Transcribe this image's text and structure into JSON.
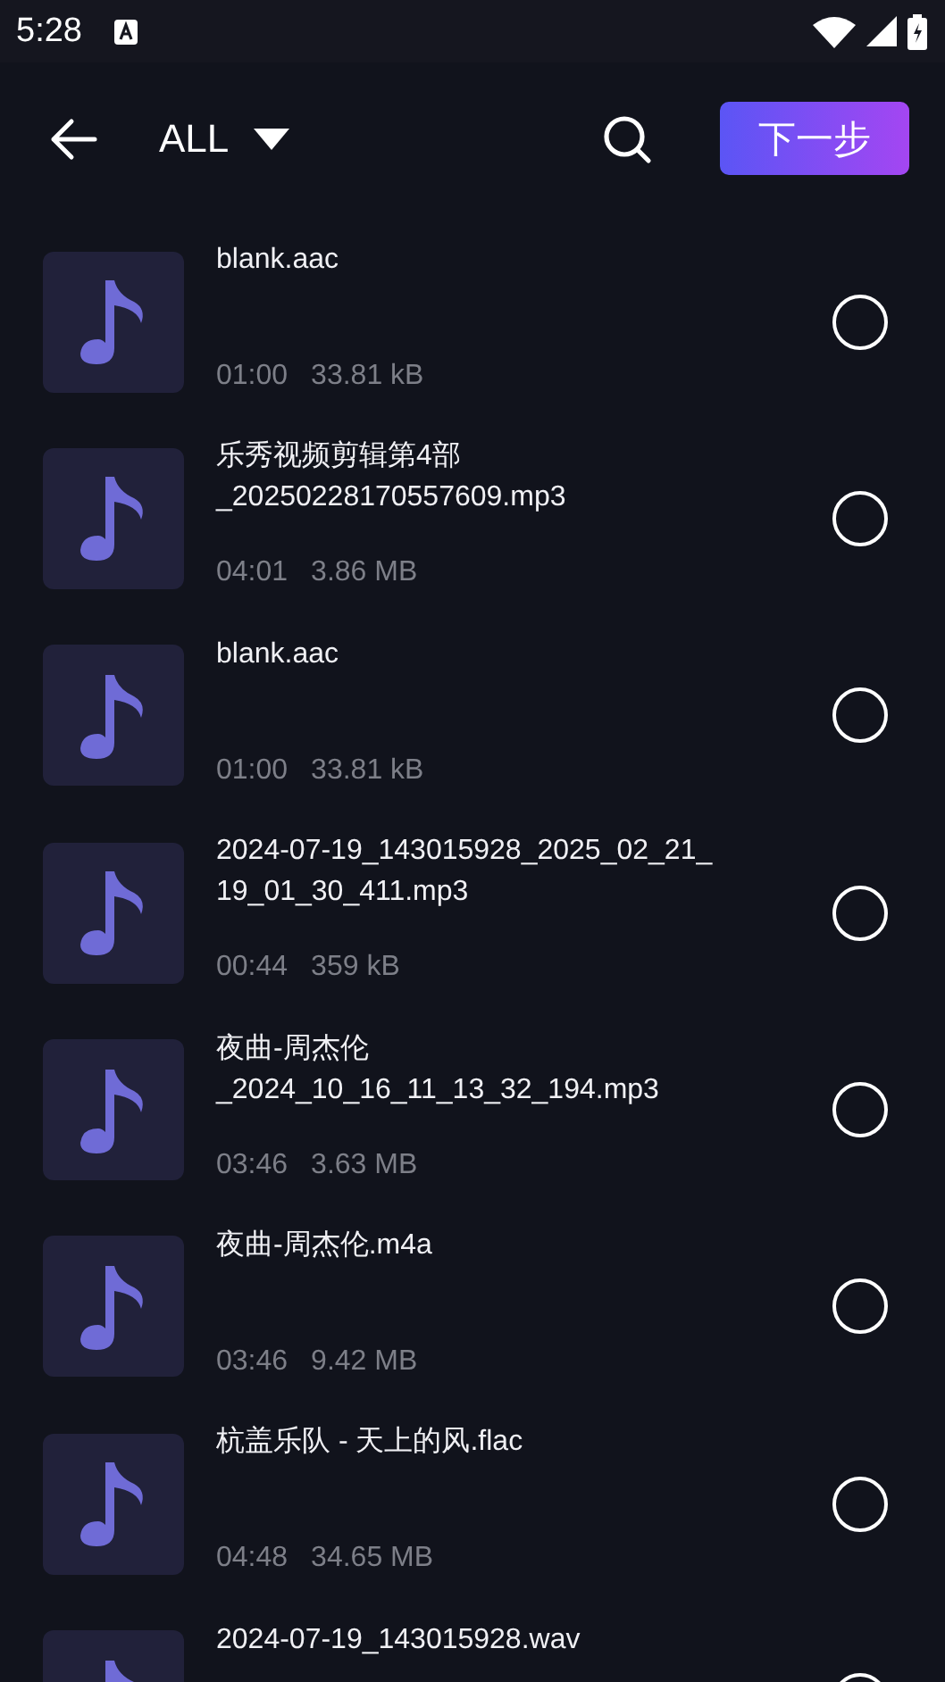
{
  "status_bar": {
    "time": "5:28"
  },
  "toolbar": {
    "filter": "ALL",
    "next_button": "下一步"
  },
  "files": [
    {
      "title": "blank.aac",
      "duration": "01:00",
      "size": "33.81 kB",
      "selected": false
    },
    {
      "title": "乐秀视频剪辑第4部\n_20250228170557609.mp3",
      "duration": "04:01",
      "size": "3.86 MB",
      "selected": false
    },
    {
      "title": "blank.aac",
      "duration": "01:00",
      "size": "33.81 kB",
      "selected": false
    },
    {
      "title": "2024-07-19_143015928_2025_02_21_\n19_01_30_411.mp3",
      "duration": "00:44",
      "size": "359 kB",
      "selected": false
    },
    {
      "title": "夜曲-周杰伦\n_2024_10_16_11_13_32_194.mp3",
      "duration": "03:46",
      "size": "3.63 MB",
      "selected": false
    },
    {
      "title": "夜曲-周杰伦.m4a",
      "duration": "03:46",
      "size": "9.42 MB",
      "selected": false
    },
    {
      "title": "杭盖乐队 - 天上的风.flac",
      "duration": "04:48",
      "size": "34.65 MB",
      "selected": false
    },
    {
      "title": "2024-07-19_143015928.wav",
      "selected": false
    }
  ]
}
